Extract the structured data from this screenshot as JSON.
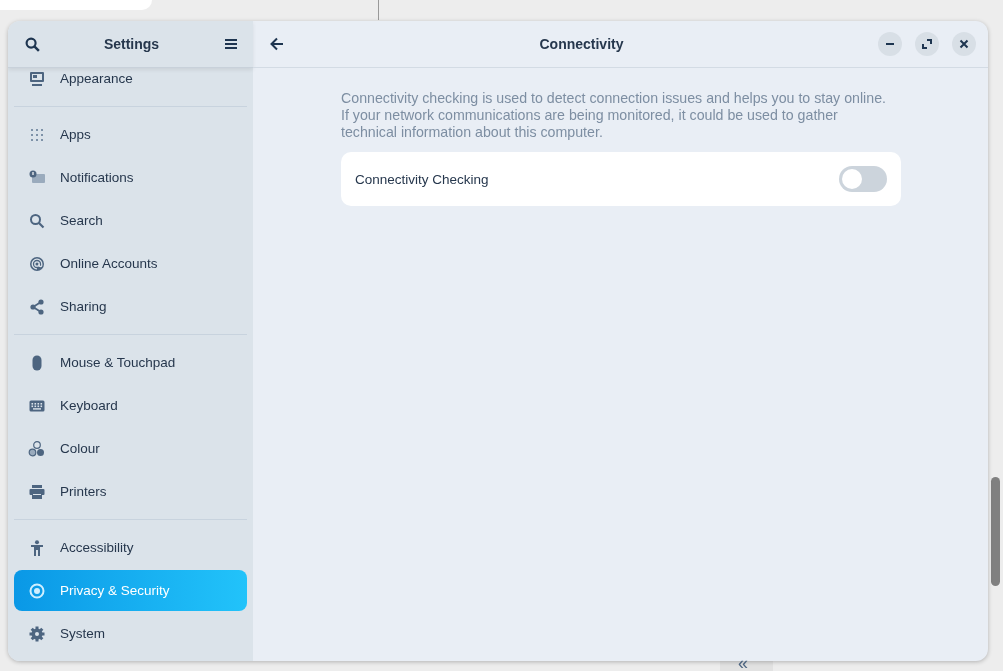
{
  "window": {
    "title": "Settings",
    "page_title": "Connectivity"
  },
  "sidebar": {
    "sections": [
      [
        {
          "label": "Appearance",
          "selected": false
        }
      ],
      [
        {
          "label": "Apps",
          "selected": false
        },
        {
          "label": "Notifications",
          "selected": false
        },
        {
          "label": "Search",
          "selected": false
        },
        {
          "label": "Online Accounts",
          "selected": false
        },
        {
          "label": "Sharing",
          "selected": false
        }
      ],
      [
        {
          "label": "Mouse & Touchpad",
          "selected": false
        },
        {
          "label": "Keyboard",
          "selected": false
        },
        {
          "label": "Colour",
          "selected": false
        },
        {
          "label": "Printers",
          "selected": false
        }
      ],
      [
        {
          "label": "Accessibility",
          "selected": false
        },
        {
          "label": "Privacy & Security",
          "selected": true
        },
        {
          "label": "System",
          "selected": false
        }
      ]
    ]
  },
  "content": {
    "description": "Connectivity checking is used to detect connection issues and helps you to stay online. If your network communications are being monitored, it could be used to gather technical information about this computer.",
    "settings": [
      {
        "label": "Connectivity Checking",
        "on": false
      }
    ]
  },
  "background_app": {
    "glyph": "«"
  }
}
